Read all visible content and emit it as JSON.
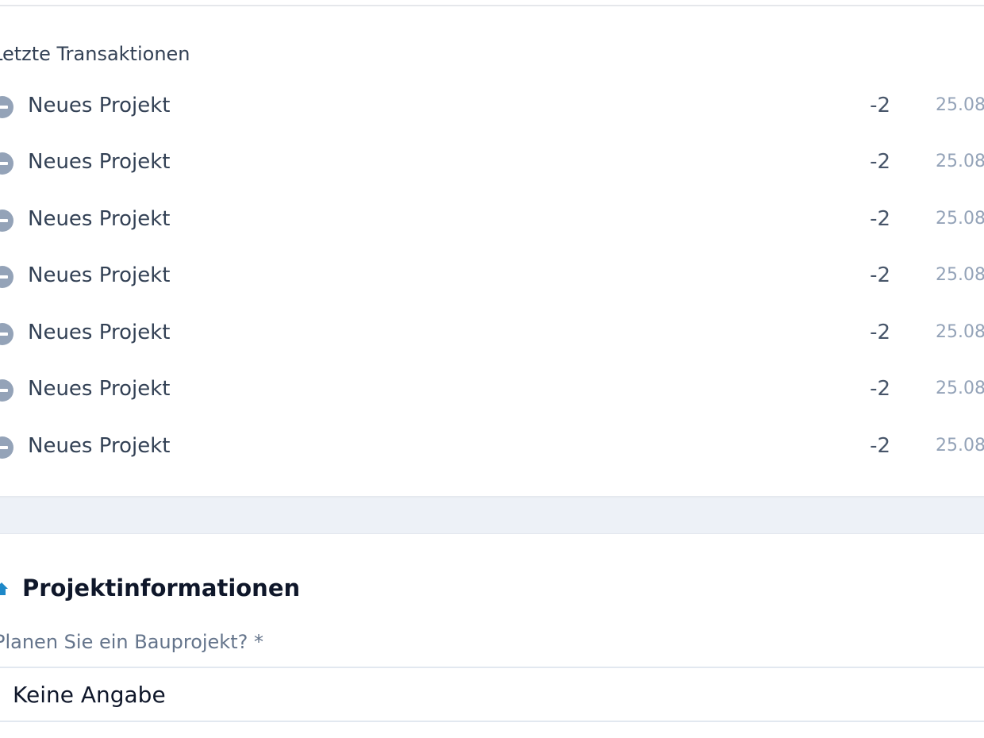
{
  "transactions": {
    "title": "Letzte Transaktionen",
    "items": [
      {
        "label": "Neues Projekt",
        "amount": "-2",
        "date": "25.08"
      },
      {
        "label": "Neues Projekt",
        "amount": "-2",
        "date": "25.08"
      },
      {
        "label": "Neues Projekt",
        "amount": "-2",
        "date": "25.08"
      },
      {
        "label": "Neues Projekt",
        "amount": "-2",
        "date": "25.08"
      },
      {
        "label": "Neues Projekt",
        "amount": "-2",
        "date": "25.08"
      },
      {
        "label": "Neues Projekt",
        "amount": "-2",
        "date": "25.08"
      },
      {
        "label": "Neues Projekt",
        "amount": "-2",
        "date": "25.08"
      }
    ],
    "item_icon": "minus-circle-icon"
  },
  "project_info": {
    "title": "Projektinformationen",
    "icon": "house-icon",
    "icon_color": "#1e88c8",
    "question": {
      "label": "Planen Sie ein Bauprojekt? *",
      "selected_value": "Keine Angabe"
    }
  }
}
